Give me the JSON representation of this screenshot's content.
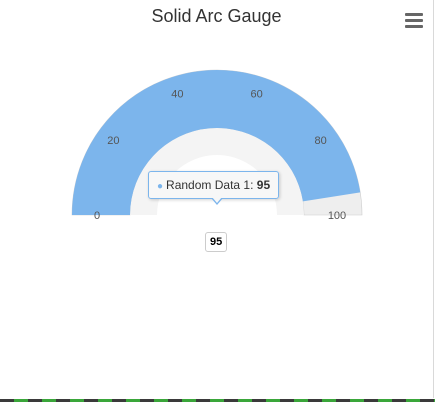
{
  "chart_data": {
    "type": "solidgauge",
    "title": "Solid Arc Gauge",
    "min": 0,
    "max": 100,
    "ticks": [
      0,
      20,
      40,
      60,
      80,
      100
    ],
    "series": [
      {
        "name": "Random Data 1",
        "values": [
          95
        ]
      }
    ],
    "colors": {
      "bar": "#7cb5ec",
      "background": "#eeeeee",
      "inner_pane": "#e6e6e6"
    }
  },
  "tooltip": {
    "series_name": "Random Data 1: ",
    "value": "95"
  },
  "data_label": "95",
  "menu_icon": "hamburger-menu-icon"
}
